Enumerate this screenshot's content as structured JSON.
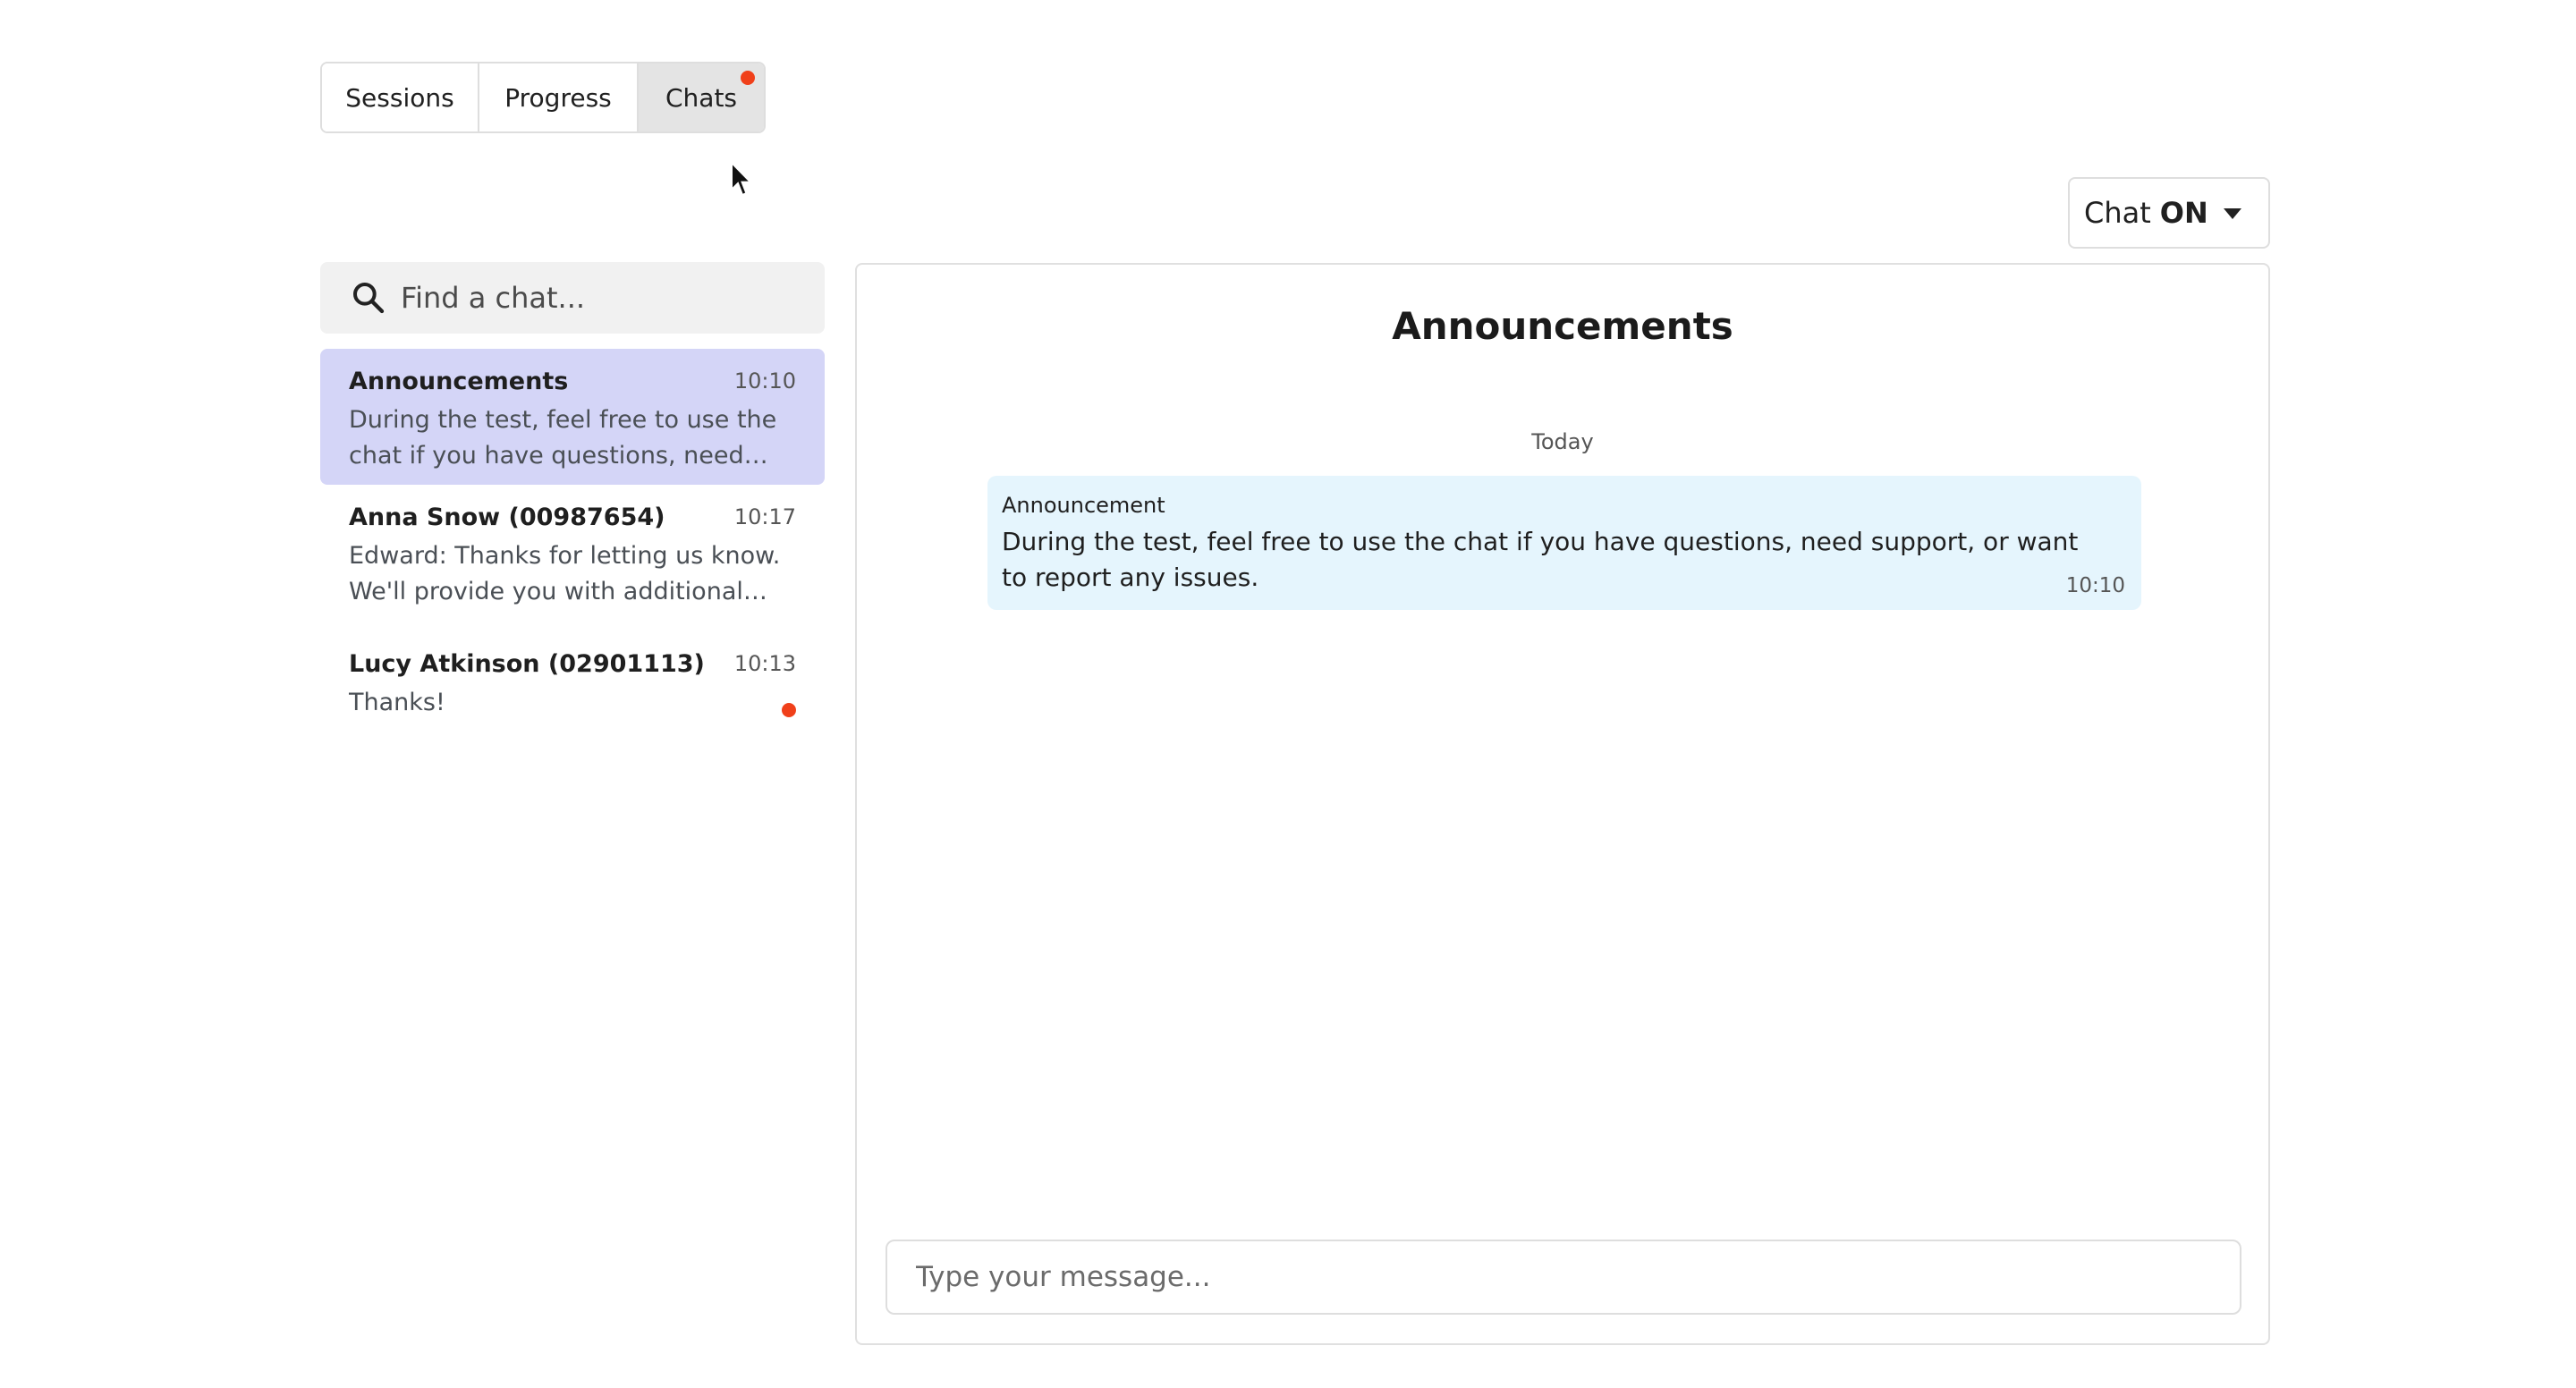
{
  "tabs": [
    {
      "label": "Sessions"
    },
    {
      "label": "Progress"
    },
    {
      "label": "Chats",
      "active": true,
      "has_notification": true
    }
  ],
  "chat_toggle": {
    "prefix": "Chat",
    "state": "ON"
  },
  "search": {
    "placeholder": "Find a chat..."
  },
  "chat_list": [
    {
      "name": "Announcements",
      "time": "10:10",
      "preview": "During the test, feel free to use the chat if you have questions, need support, or want to report any issues.",
      "active": true
    },
    {
      "name": "Anna Snow (00987654)",
      "time": "10:17",
      "preview": "Edward: Thanks for letting us know. We'll provide you with additional time."
    },
    {
      "name": "Lucy Atkinson (02901113)",
      "time": "10:13",
      "preview": "Thanks!",
      "unread": true
    }
  ],
  "conversation": {
    "title": "Announcements",
    "day_label": "Today",
    "messages": [
      {
        "sender": "Announcement",
        "text": "During the test, feel free to use the chat if you have questions, need support, or want to report any issues.",
        "time": "10:10"
      }
    ]
  },
  "composer": {
    "placeholder": "Type your message..."
  },
  "colors": {
    "accent_active_item": "#d4d5f7",
    "notification_dot": "#f0401a",
    "message_bubble": "#e5f5fd"
  }
}
